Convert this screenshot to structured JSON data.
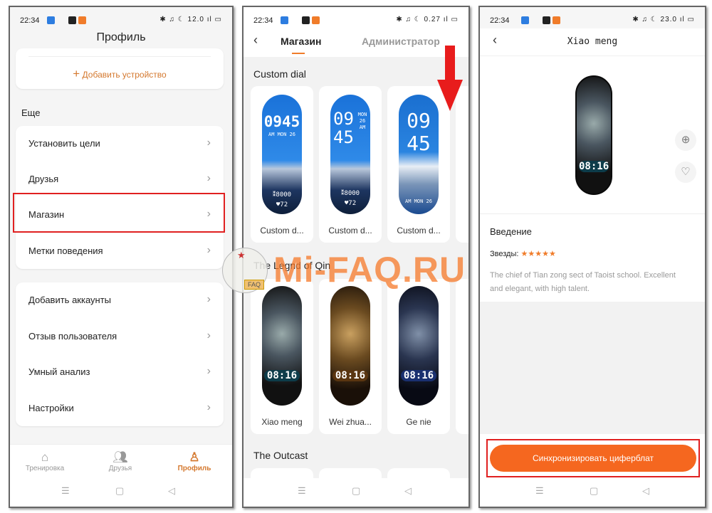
{
  "status": {
    "time": "22:34",
    "left_speed": "12.0",
    "middle_speed": "0.27",
    "right_speed": "23.0",
    "battery": "66"
  },
  "left": {
    "title": "Профиль",
    "add_device": "Добавить устройство",
    "section": "Еще",
    "group1": [
      "Установить цели",
      "Друзья",
      "Магазин",
      "Метки поведения"
    ],
    "group2": [
      "Добавить аккаунты",
      "Отзыв пользователя",
      "Умный анализ",
      "Настройки"
    ],
    "bottom_nav": [
      {
        "label": "Тренировка",
        "icon": "home-icon"
      },
      {
        "label": "Друзья",
        "icon": "friends-icon"
      },
      {
        "label": "Профиль",
        "icon": "profile-icon",
        "active": true
      }
    ]
  },
  "middle": {
    "tabs": [
      "Магазин",
      "Администратор"
    ],
    "active_tab": "Магазин",
    "sections": [
      {
        "title": "Custom dial",
        "items": [
          "Custom d...",
          "Custom d...",
          "Custom d..."
        ]
      },
      {
        "title": "The Legnd of Qin",
        "items": [
          "Xiao meng",
          "Wei zhua...",
          "Ge nie"
        ]
      },
      {
        "title": "The Outcast",
        "items": []
      }
    ],
    "dial_texts": {
      "d1_time": "0945",
      "d1_sub": "AM MON 26",
      "steps": "8000",
      "heart": "72",
      "d2_time1": "09",
      "d2_time2": "45",
      "d2_side": "MON 26 AM",
      "d3_time1": "09",
      "d3_time2": "45",
      "d3_sub": "AM MON 26",
      "qin_time": "08:16"
    }
  },
  "right": {
    "title": "Xiao meng",
    "watch_time": "08:16",
    "intro": "Введение",
    "stars_label": "Звезды:",
    "stars": 5,
    "stars_text": "★★★★★",
    "description": "The chief of Tian zong sect of Taoist school. Excellent and elegant, with high talent.",
    "sync_button": "Синхронизировать циферблат"
  },
  "watermark": {
    "text": "Mi-FAQ.RU",
    "badge": "FAQ"
  },
  "colors": {
    "accent": "#f07c2a",
    "highlight": "#e02020",
    "button": "#f5671f"
  }
}
